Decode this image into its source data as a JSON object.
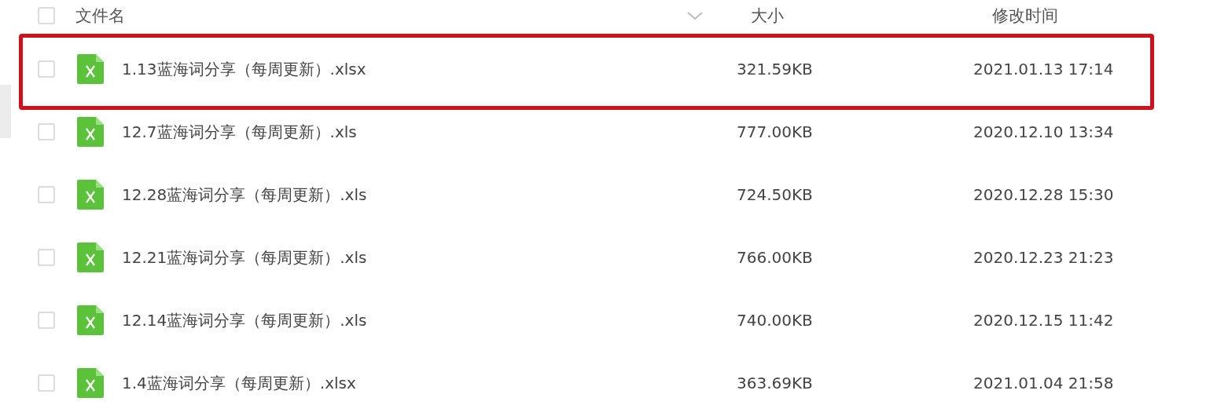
{
  "header": {
    "checked": false,
    "columns": [
      "文件名",
      "大小",
      "修改时间"
    ]
  },
  "files": [
    {
      "name": "1.13蓝海词分享（每周更新）.xlsx",
      "size": "321.59KB",
      "modified": "2021.01.13 17:14",
      "checked": false,
      "highlighted": true
    },
    {
      "name": "12.7蓝海词分享（每周更新）.xls",
      "size": "777.00KB",
      "modified": "2020.12.10 13:34",
      "checked": false,
      "highlighted": false
    },
    {
      "name": "12.28蓝海词分享（每周更新）.xls",
      "size": "724.50KB",
      "modified": "2020.12.28 15:30",
      "checked": false,
      "highlighted": false
    },
    {
      "name": "12.21蓝海词分享（每周更新）.xls",
      "size": "766.00KB",
      "modified": "2020.12.23 21:23",
      "checked": false,
      "highlighted": false
    },
    {
      "name": "12.14蓝海词分享（每周更新）.xls",
      "size": "740.00KB",
      "modified": "2020.12.15 11:42",
      "checked": false,
      "highlighted": false
    },
    {
      "name": "1.4蓝海词分享（每周更新）.xlsx",
      "size": "363.69KB",
      "modified": "2021.01.04 21:58",
      "checked": false,
      "highlighted": false
    }
  ]
}
